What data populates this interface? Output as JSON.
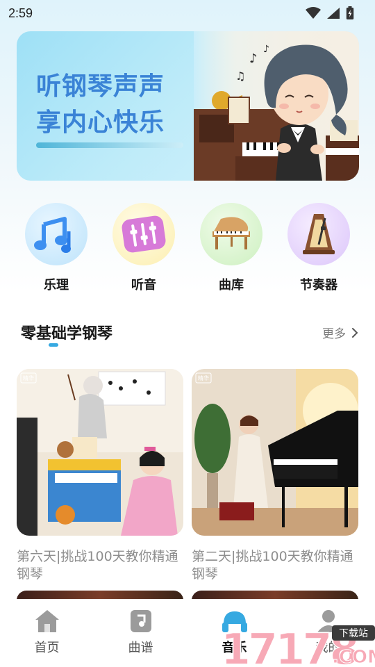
{
  "status": {
    "time": "2:59"
  },
  "banner": {
    "line1": "听钢琴声声",
    "line2": "享内心快乐"
  },
  "categories": [
    {
      "label": "乐理",
      "icon": "music-notes-icon"
    },
    {
      "label": "听音",
      "icon": "equalizer-icon"
    },
    {
      "label": "曲库",
      "icon": "grand-piano-icon"
    },
    {
      "label": "节奏器",
      "icon": "metronome-icon"
    }
  ],
  "section": {
    "title": "零基础学钢琴",
    "more": "更多"
  },
  "cards": [
    {
      "title": "第六天|挑战100天教你精通钢琴",
      "badge": "精华"
    },
    {
      "title": "第二天|挑战100天教你精通钢琴",
      "badge": "精华"
    }
  ],
  "tabs": [
    {
      "label": "首页",
      "icon": "home-icon",
      "active": false
    },
    {
      "label": "曲谱",
      "icon": "sheet-music-icon",
      "active": false
    },
    {
      "label": "音乐",
      "icon": "music-icon",
      "active": true
    },
    {
      "label": "我的",
      "icon": "profile-icon",
      "active": false
    }
  ],
  "watermark": {
    "text": "17178",
    "sub": "下载站",
    "domain": ".COM"
  },
  "colors": {
    "accent": "#36a9e1",
    "banner_title": "#3a83d6",
    "card_title": "#8e8e8e"
  }
}
